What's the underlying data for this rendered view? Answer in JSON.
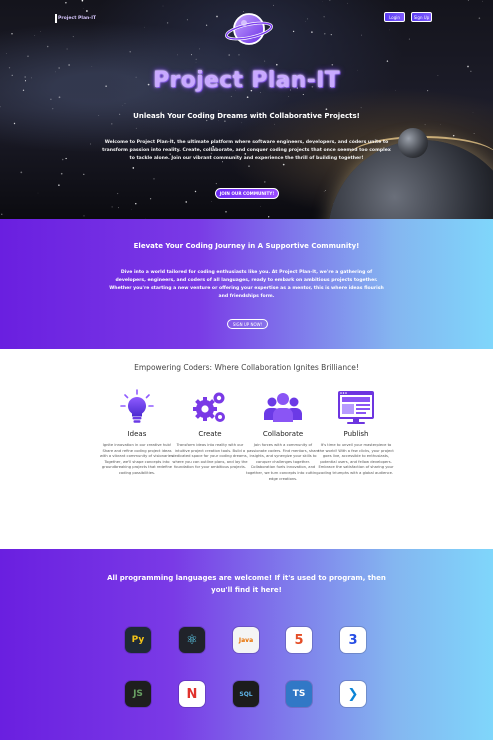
{
  "header": {
    "logo_text": "Project Plan-IT",
    "login_label": "Login",
    "signup_label": "Sign Up"
  },
  "hero": {
    "title": "Project Plan-IT",
    "subtitle": "Unleash Your Coding Dreams with Collaborative Projects!",
    "description": "Welcome to Project Plan-It, the ultimate platform where software engineers, developers, and coders unite to transform passion into reality. Create, collaborate, and conquer coding projects that once seemed too complex to tackle alone. Join our vibrant community and experience the thrill of building together!",
    "cta_label": "JOIN OUR COMMUNITY!"
  },
  "community": {
    "title": "Elevate Your Coding Journey in A Supportive Community!",
    "description": "Dive into a world tailored for coding enthusiasts like you. At Project Plan-It, we're a gathering of developers, engineers, and coders of all languages, ready to embark on ambitious projects together. Whether you're starting a new venture or offering your expertise as a mentor, this is where ideas flourish and friendships form.",
    "cta_label": "SIGN UP NOW!"
  },
  "features": {
    "title": "Empowering Coders: Where Collaboration Ignites Brilliance!",
    "items": [
      {
        "name": "Ideas",
        "icon": "lightbulb-icon",
        "description": "Ignite innovation in our creative hub! Share and refine coding project ideas with a vibrant community of visionaries. Together, we'll shape concepts into groundbreaking projects that redefine coding possibilities."
      },
      {
        "name": "Create",
        "icon": "gears-icon",
        "description": "Transform ideas into reality with our intuitive project creation tools. Build a dedicated space for your coding dreams, where you can outline plans, and lay the foundation for your ambitious projects."
      },
      {
        "name": "Collaborate",
        "icon": "team-icon",
        "description": "Join forces with a community of passionate coders. Find mentors, share insights, and synergize your skills to conquer challenges together. Collaboration fuels innovation, and together, we turn concepts into cutting-edge creations."
      },
      {
        "name": "Publish",
        "icon": "publish-website-icon",
        "description": "It's time to unveil your masterpiece to the world! With a few clicks, your project goes live, accessible to enthusiasts, potential users, and fellow developers. Embrace the satisfaction of sharing your coding triumphs with a global audience."
      }
    ]
  },
  "languages": {
    "title": "All programming languages are welcome! If it's used to program, then you'll find it here!",
    "row1": [
      {
        "name": "python-icon",
        "glyph": "Py",
        "bg": "#1f2a36",
        "fg": "#f5c518"
      },
      {
        "name": "react-icon",
        "glyph": "⚛",
        "bg": "#20232a",
        "fg": "#61dafb"
      },
      {
        "name": "java-icon",
        "glyph": "Java",
        "bg": "#f4f4f4",
        "fg": "#e76f00"
      },
      {
        "name": "html5-icon",
        "glyph": "5",
        "bg": "#ffffff",
        "fg": "#e44d26"
      },
      {
        "name": "css3-icon",
        "glyph": "3",
        "bg": "#ffffff",
        "fg": "#264de4"
      }
    ],
    "row2": [
      {
        "name": "nodejs-icon",
        "glyph": "JS",
        "bg": "#1e1e1e",
        "fg": "#68a063"
      },
      {
        "name": "nativescript-icon",
        "glyph": "N",
        "bg": "#ffffff",
        "fg": "#e0322c"
      },
      {
        "name": "sql-icon",
        "glyph": "SQL",
        "bg": "#1c1c1c",
        "fg": "#5fb3e6"
      },
      {
        "name": "typescript-icon",
        "glyph": "TS",
        "bg": "#3178c6",
        "fg": "#ffffff"
      },
      {
        "name": "vscode-icon",
        "glyph": "❯",
        "bg": "#ffffff",
        "fg": "#0a84d6"
      }
    ]
  }
}
